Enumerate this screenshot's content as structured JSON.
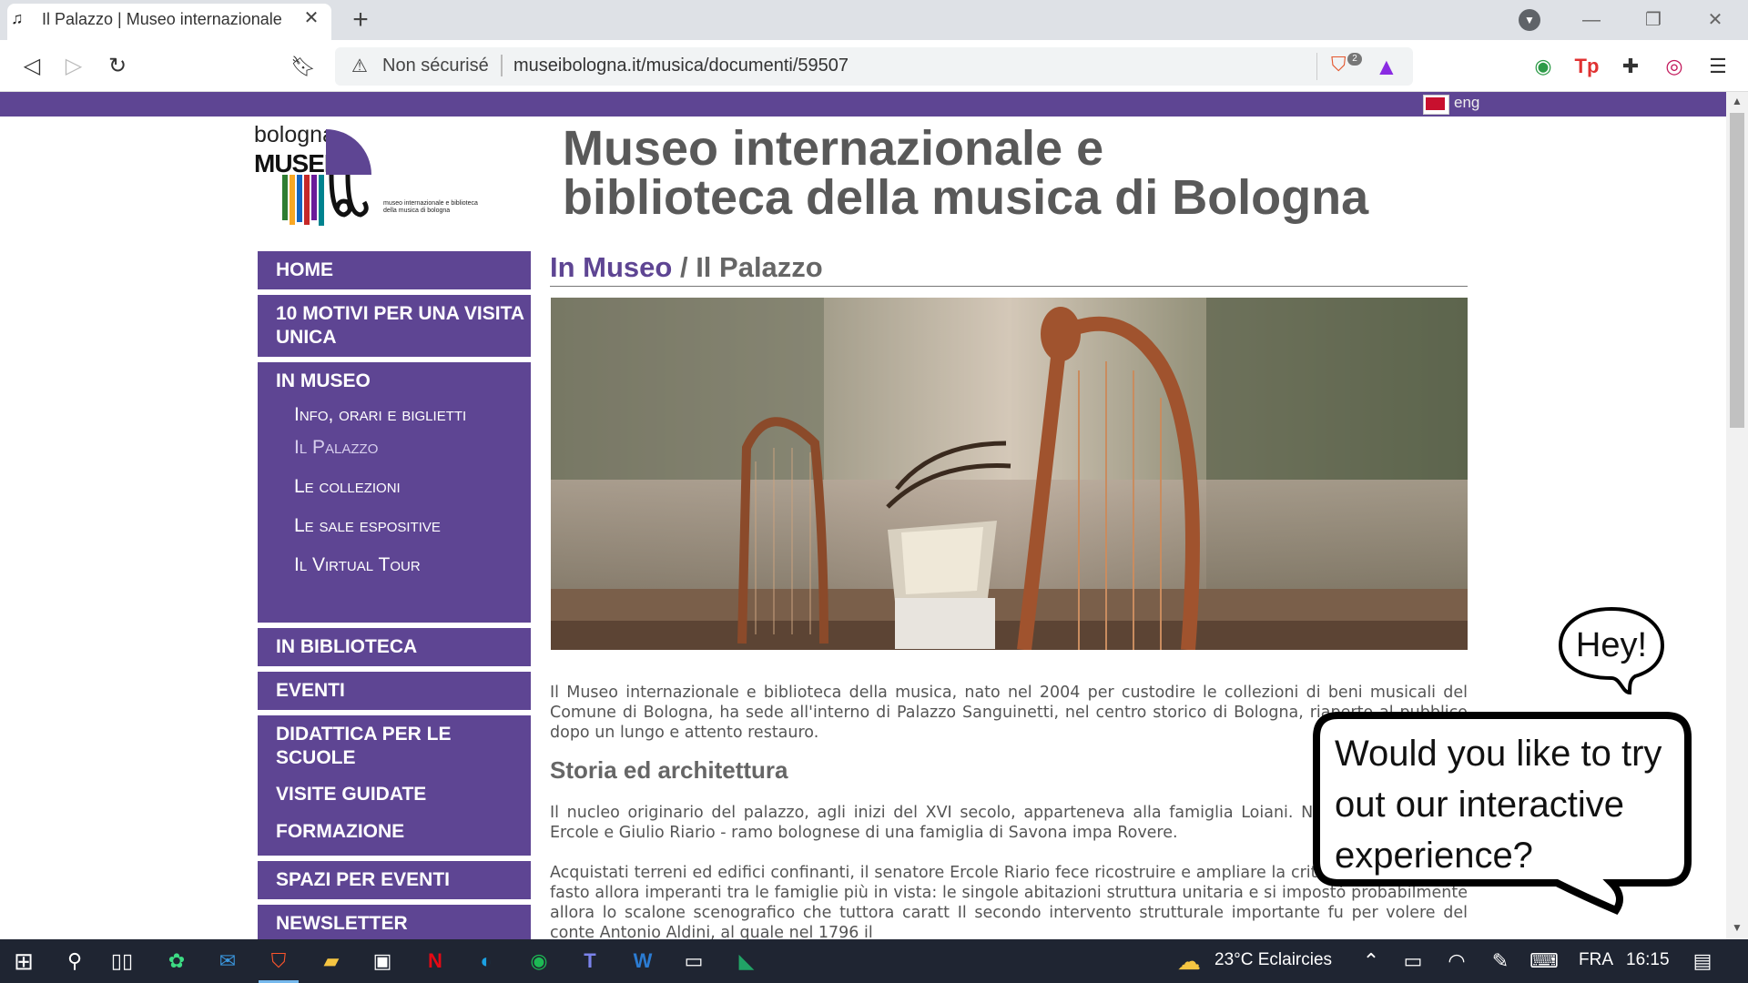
{
  "browser": {
    "tab_title": "Il Palazzo | Museo internazionale",
    "insecure_label": "Non sécurisé",
    "url": "museibologna.it/musica/documenti/59507",
    "brave_shield_count": "2"
  },
  "page": {
    "lang": "eng",
    "logo": {
      "city": "bologna",
      "brand": "MUSEI",
      "sub": "museo internazionale e biblioteca della musica di bologna"
    },
    "site_title_line1": "Museo internazionale e",
    "site_title_line2": "biblioteca della musica di Bologna",
    "nav": {
      "home": "HOME",
      "motivi": "10 MOTIVI PER UNA VISITA UNICA",
      "in_museo": "IN MUSEO",
      "sub_info": "Info, orari e biglietti",
      "sub_palazzo": "Il Palazzo",
      "sub_collezioni": "Le collezioni",
      "sub_sale": "Le sale espositive",
      "sub_tour": "Il Virtual Tour",
      "biblioteca": "IN BIBLIOTECA",
      "eventi": "EVENTI",
      "didattica": "DIDATTICA PER LE SCUOLE",
      "visite": "VISITE GUIDATE",
      "formazione": "FORMAZIONE",
      "spazi": "SPAZI PER EVENTI",
      "newsletter": "NEWSLETTER"
    },
    "breadcrumb": {
      "section": "In Museo",
      "separator": " / ",
      "current": "Il Palazzo"
    },
    "intro": "Il Museo internazionale e biblioteca della musica, nato nel 2004 per custodire le collezioni di beni musicali del Comune di Bologna, ha sede all'interno di Palazzo Sanguinetti, nel centro storico di Bologna, riaperto al pubblico dopo un lungo e attento restauro.",
    "section_heading": "Storia ed architettura",
    "para1": "Il nucleo originario del palazzo, agli inizi del XVI secolo, apparteneva alla famiglia Loiani. N venduto ai fratelli Ercole e Giulio Riario - ramo bolognese di una famiglia di Savona impa Rovere.",
    "para2": "Acquistati terreni ed edifici confinanti, il senatore Ercole Riario fece ricostruire e ampliare la criteri di grandiosità e fasto allora imperanti tra le famiglie più in vista: le singole abitazioni struttura unitaria e si impostò probabilmente allora lo scalone scenografico che tuttora caratt Il secondo intervento strutturale importante fu per volere del conte Antonio Aldini, al quale nel 1796 il"
  },
  "popup": {
    "hey": "Hey!",
    "question": "Would you like to try out our interactive experience?"
  },
  "taskbar": {
    "weather": "23°C  Eclaircies",
    "lang": "FRA",
    "time": "16:15"
  },
  "colors": {
    "brand_purple": "#5e4593",
    "taskbar": "#1f2532"
  }
}
